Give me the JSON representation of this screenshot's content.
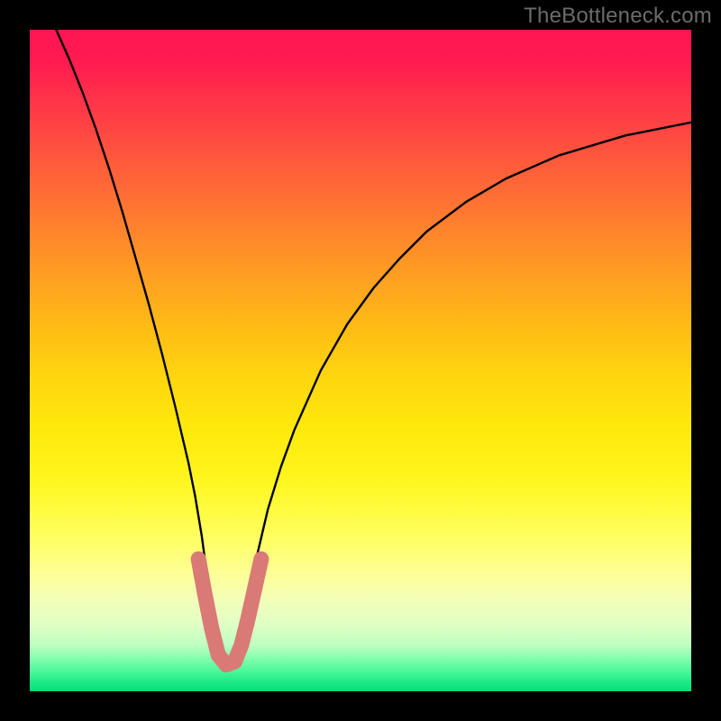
{
  "watermark": "TheBottleneck.com",
  "chart_data": {
    "type": "line",
    "title": "",
    "xlabel": "",
    "ylabel": "",
    "xlim": [
      0,
      100
    ],
    "ylim": [
      0,
      100
    ],
    "series": [
      {
        "name": "bottleneck-curve",
        "x": [
          4,
          6,
          8,
          10,
          12,
          14,
          16,
          18,
          20,
          22,
          24,
          25,
          26,
          27,
          28,
          29,
          30,
          31,
          32,
          33,
          34,
          36,
          38,
          40,
          44,
          48,
          52,
          56,
          60,
          66,
          72,
          80,
          90,
          100
        ],
        "y": [
          100,
          95.5,
          90.5,
          85,
          79,
          72.5,
          65.5,
          58.5,
          51,
          43,
          34.5,
          29.5,
          23.5,
          16,
          8,
          4,
          3.5,
          4,
          8.5,
          14,
          19,
          27.5,
          34,
          39.5,
          48.5,
          55.5,
          61,
          65.5,
          69.5,
          74,
          77.5,
          81,
          84,
          86
        ]
      }
    ],
    "highlight": {
      "name": "bottleneck-min-range",
      "type": "segment",
      "color": "#d97a77",
      "x": [
        25.5,
        26.5,
        27.5,
        28.5,
        29.7,
        31,
        32,
        33,
        34,
        35
      ],
      "y": [
        20,
        14.5,
        9.5,
        5.5,
        4,
        4.5,
        7,
        11,
        15.5,
        20
      ]
    },
    "gradient_stops": [
      {
        "pos": 0.0,
        "color": "#ff1552"
      },
      {
        "pos": 0.2,
        "color": "#ff5a3c"
      },
      {
        "pos": 0.4,
        "color": "#ffb316"
      },
      {
        "pos": 0.58,
        "color": "#ffe80d"
      },
      {
        "pos": 0.72,
        "color": "#fffb3a"
      },
      {
        "pos": 0.86,
        "color": "#dfffc5"
      },
      {
        "pos": 0.95,
        "color": "#86feae"
      },
      {
        "pos": 1.0,
        "color": "#04e07d"
      }
    ]
  }
}
